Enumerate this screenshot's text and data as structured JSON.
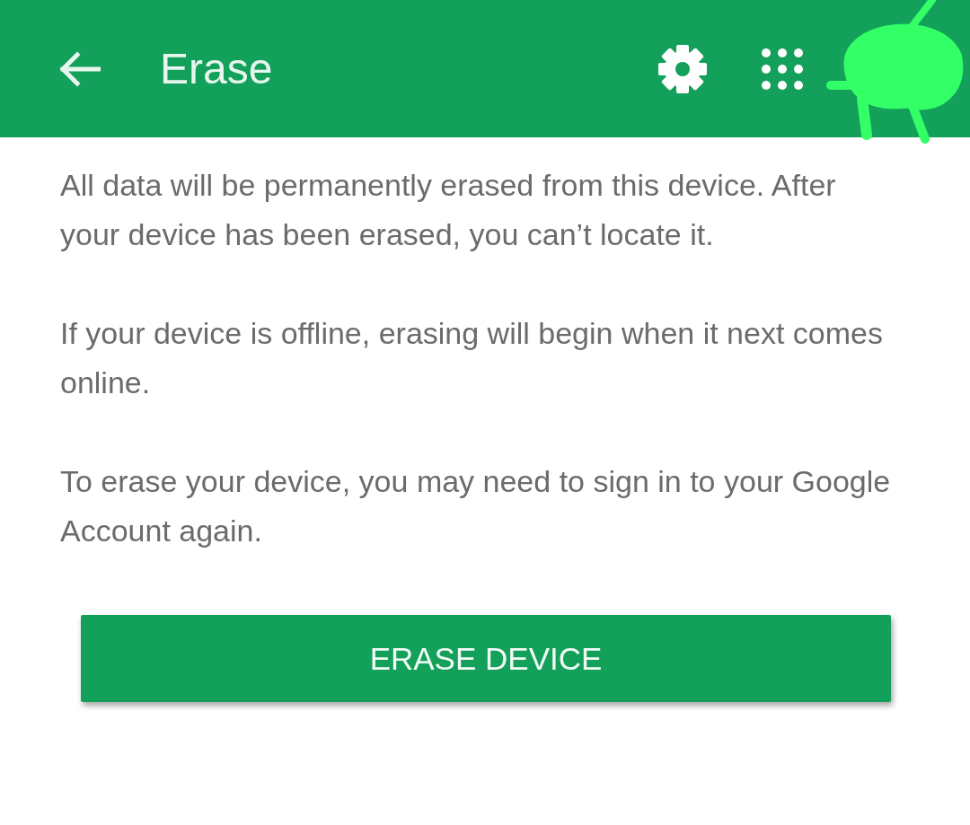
{
  "app_bar": {
    "title": "Erase"
  },
  "paragraphs": [
    "All data will be permanently erased from this device. After your device has been erased, you can’t locate it.",
    "If your device is offline, erasing will begin when it next comes online.",
    "To erase your device, you may need to sign in to your Google Account again."
  ],
  "button": {
    "label": "ERASE DEVICE"
  }
}
